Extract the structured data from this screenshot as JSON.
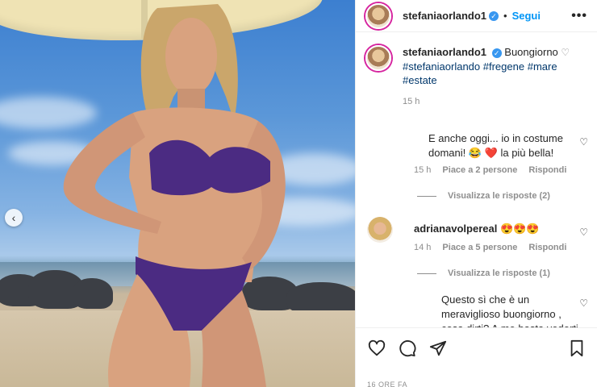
{
  "post": {
    "author": "stefaniaorlando1",
    "follow_label": "Segui",
    "dot": "•",
    "more_label": "•••"
  },
  "caption": {
    "username": "stefaniaorlando1",
    "text": "Buongiorno",
    "hashtags": [
      "#stefaniaorlando",
      "#fregene",
      "#mare",
      "#estate"
    ],
    "time": "15 h"
  },
  "comments": [
    {
      "text": "E anche oggi... io in costume domani! 😂 ❤️  la più bella!",
      "time": "15 h",
      "likes": "Piace a 2 persone",
      "reply": "Rispondi",
      "view_replies": "Visualizza le risposte (2)"
    },
    {
      "username": "adrianavolpereal",
      "emoji": "😍😍😍",
      "time": "14 h",
      "likes": "Piace a 5 persone",
      "reply": "Rispondi",
      "view_replies": "Visualizza le risposte (1)"
    },
    {
      "text": "Questo sì che è un meraviglioso buongiorno , cosa dirti? A me basta vederti sorridere"
    }
  ],
  "footer": {
    "timestamp": "16 ORE FA"
  },
  "colors": {
    "link": "#0095f6",
    "hashtag": "#00376b",
    "muted": "#8e8e8e"
  },
  "icons": {
    "like": "heart-icon",
    "comment": "comment-icon",
    "share": "share-icon",
    "save": "bookmark-icon",
    "prev": "chevron-left-icon"
  }
}
